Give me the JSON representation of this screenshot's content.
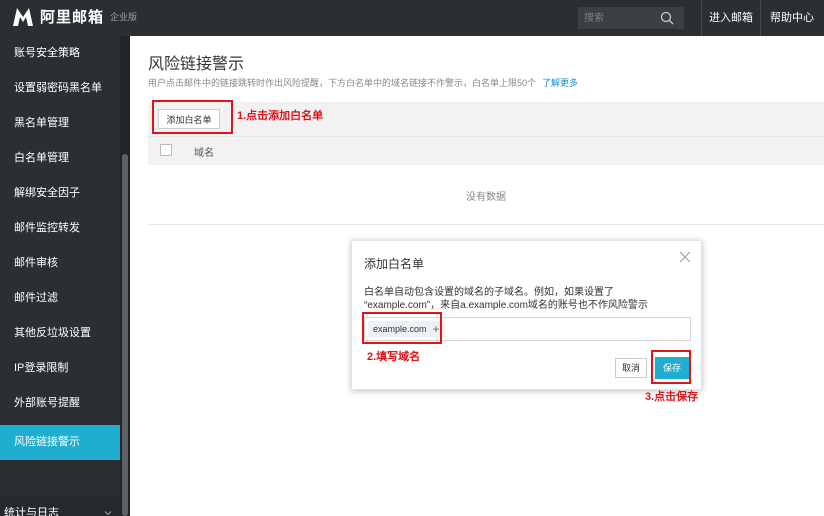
{
  "header": {
    "logo_text": "阿里邮箱",
    "logo_badge": "企业版",
    "search_placeholder": "搜索",
    "enter_mail": "进入邮箱",
    "help_center": "帮助中心"
  },
  "sidebar": {
    "items": [
      {
        "label": "账号安全策略"
      },
      {
        "label": "设置弱密码黑名单"
      },
      {
        "label": "黑名单管理"
      },
      {
        "label": "白名单管理"
      },
      {
        "label": "解绑安全因子"
      },
      {
        "label": "邮件监控转发"
      },
      {
        "label": "邮件审核"
      },
      {
        "label": "邮件过滤"
      },
      {
        "label": "其他反垃圾设置"
      },
      {
        "label": "IP登录限制"
      },
      {
        "label": "外部账号提醒"
      },
      {
        "label": "风险链接警示"
      }
    ],
    "active_index": 11,
    "group_label": "统计与日志"
  },
  "main": {
    "title": "风险链接警示",
    "description": "用户点击邮件中的链接跳转时作出风险提醒，下方白名单中的域名链接不作警示，白名单上限50个",
    "learn_more": "了解更多",
    "add_button": "添加白名单",
    "column_domain": "域名",
    "empty_text": "没有数据"
  },
  "modal": {
    "title": "添加白名单",
    "desc_line1": "白名单自动包含设置的域名的子域名。例如，如果设置了",
    "desc_line2": "“example.com”，来自a.example.com域名的账号也不作风险警示",
    "domain_tag": "example.com",
    "cancel": "取消",
    "save": "保存"
  },
  "annotations": {
    "step1": "1.点击添加白名单",
    "step2": "2.填写域名",
    "step3": "3.点击保存"
  },
  "colors": {
    "accent": "#1faed0",
    "annotation_red": "#e0141d",
    "dark_bg": "#2b2f33"
  }
}
